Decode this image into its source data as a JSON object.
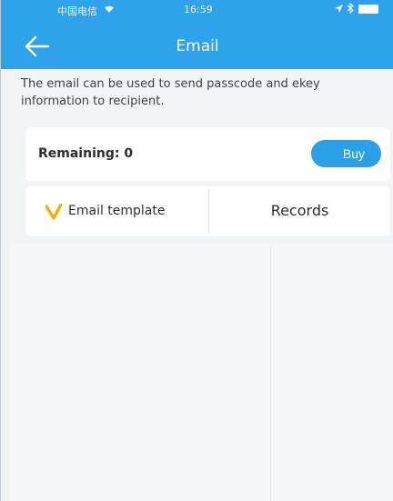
{
  "status_bar": {
    "carrier": "中国电信",
    "time": "16:59"
  },
  "header": {
    "title": "Email",
    "back_icon": "back-arrow-icon"
  },
  "description": "The email can be used to send passcode and ekey information to recipient.",
  "remaining": {
    "label": "Remaining: 0",
    "buy_label": "Buy"
  },
  "tabs": {
    "email_template": {
      "label": "Email template",
      "icon": "check-icon"
    },
    "records": {
      "label": "Records"
    }
  },
  "colors": {
    "header": "#2ea2ea",
    "buy_button": "#2ba0e6",
    "check_mark": "#f0b400",
    "background": "#f2f4f6"
  }
}
